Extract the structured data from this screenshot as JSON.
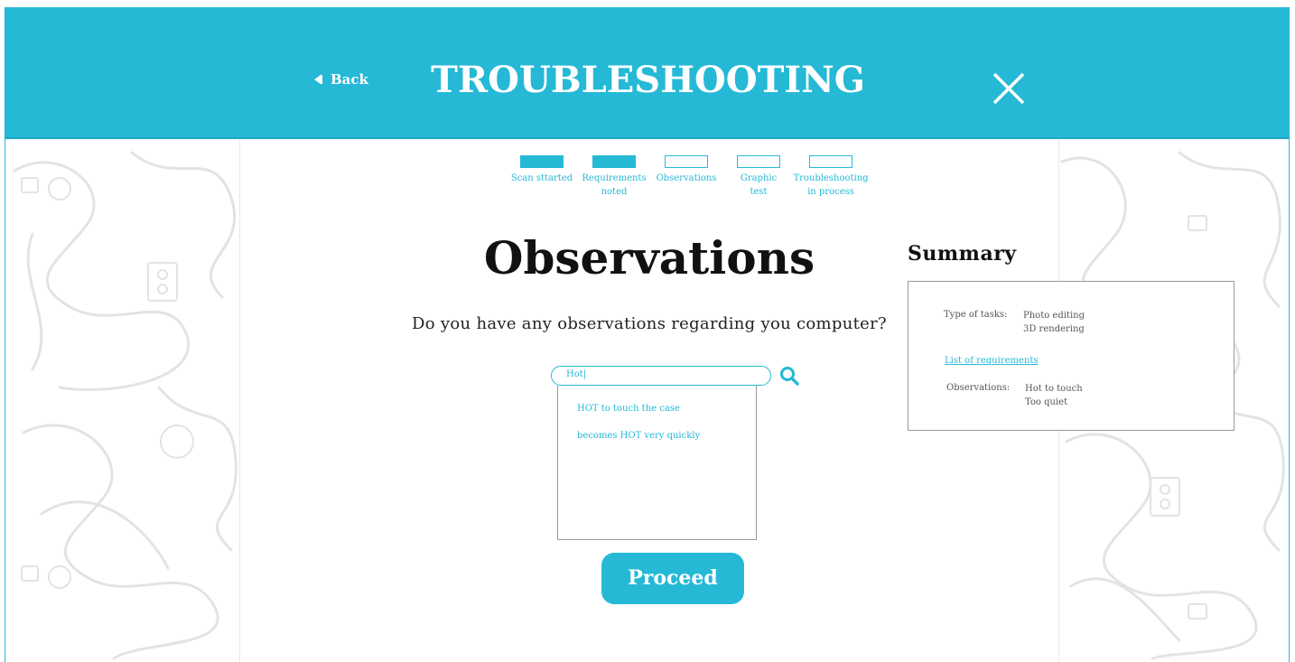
{
  "header": {
    "back_label": "Back",
    "title": "TROUBLESHOOTING"
  },
  "steps": [
    {
      "label_line1": "Scan sttarted",
      "label_line2": "",
      "completed": true
    },
    {
      "label_line1": "Requirements",
      "label_line2": "noted",
      "completed": true
    },
    {
      "label_line1": "Observations",
      "label_line2": "",
      "completed": false
    },
    {
      "label_line1": "Graphic",
      "label_line2": "test",
      "completed": false
    },
    {
      "label_line1": "Troubleshooting",
      "label_line2": "in process",
      "completed": false
    }
  ],
  "main": {
    "heading": "Observations",
    "question": "Do you have any observations regarding you computer?",
    "search_value": "Hot|",
    "suggestions": [
      "HOT to touch the case",
      "becomes HOT very quickly"
    ],
    "proceed_label": "Proceed"
  },
  "summary": {
    "title": "Summary",
    "tasks_label": "Type of tasks:",
    "tasks_values": [
      "Photo editing",
      "3D rendering"
    ],
    "requirements_link": "List of requirements",
    "observations_label": "Observations:",
    "observations_values": [
      "Hot to touch",
      "Too quiet"
    ]
  },
  "colors": {
    "accent": "#25b9d6",
    "text": "#111111"
  },
  "icons": {
    "back": "triangle-left-icon",
    "close": "close-icon",
    "search": "search-icon"
  }
}
